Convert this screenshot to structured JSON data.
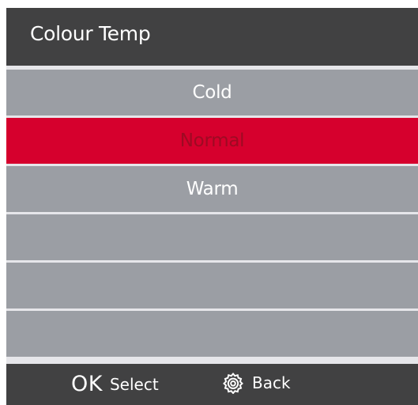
{
  "header": {
    "title": "Colour Temp"
  },
  "menu": {
    "items": [
      {
        "label": "Cold"
      },
      {
        "label": "Normal",
        "selected": true
      },
      {
        "label": "Warm"
      },
      {
        "label": ""
      },
      {
        "label": ""
      },
      {
        "label": ""
      }
    ]
  },
  "footer": {
    "ok_glyph": "OK",
    "select_label": "Select",
    "back_icon": "gear-icon",
    "back_label": "Back"
  },
  "colors": {
    "header_bg": "#414142",
    "item_bg": "#9b9ea4",
    "selected_bg": "#d6002d",
    "selected_text": "#9e0a23",
    "separator": "#e6e6ea"
  }
}
